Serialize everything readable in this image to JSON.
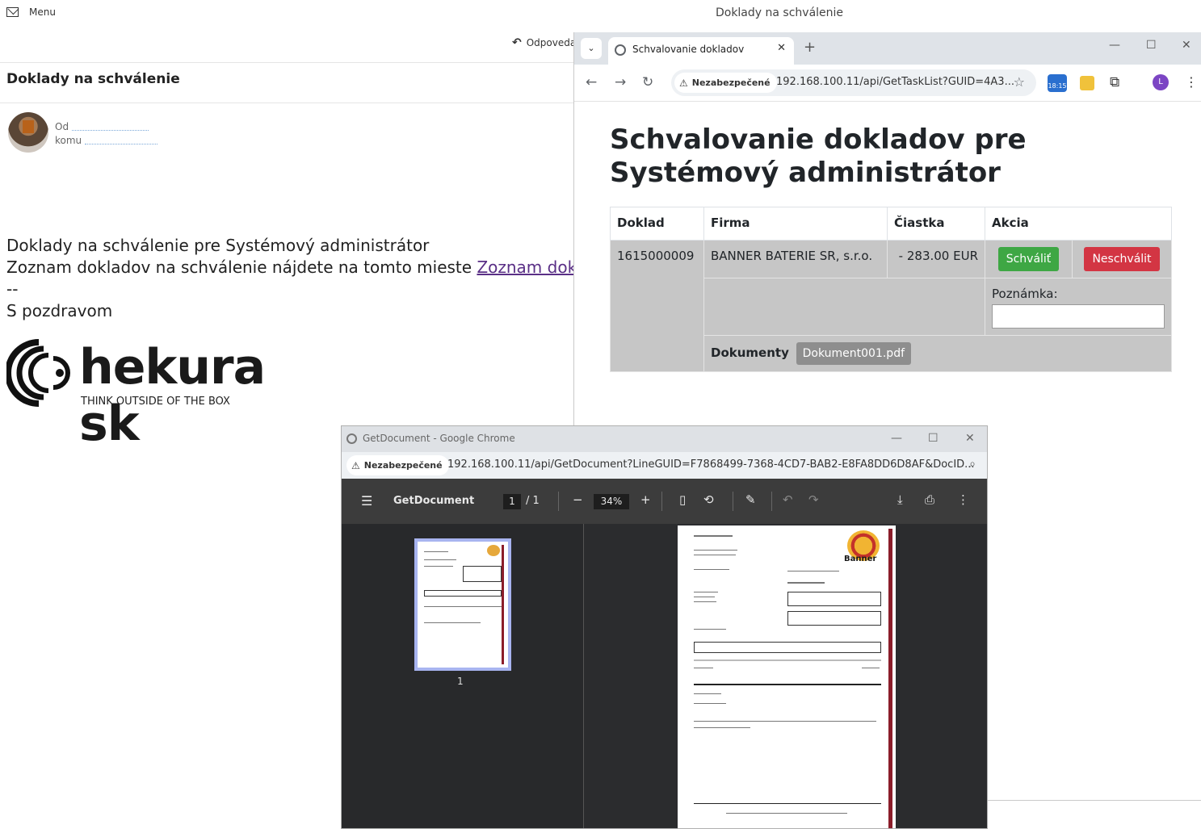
{
  "mail": {
    "menu_label": "Menu",
    "window_title": "Doklady na schválenie",
    "reply_label": "Odpoveda",
    "subject": "Doklady na schválenie",
    "from_prefix": "Od",
    "to_prefix": "komu",
    "body_line1": "Doklady na schválenie pre Systémový administrátor",
    "body_line2_prefix": "Zoznam dokladov na schválenie nájdete na tomto mieste ",
    "body_link": "Zoznam dokladov",
    "body_sep": "--",
    "body_greeting": "S pozdravom",
    "logo_text": "hekura sk",
    "logo_tagline": "THINK OUTSIDE OF THE BOX"
  },
  "browser1": {
    "tab_title": "Schvalovanie dokladov",
    "security_label": "Nezabezpečené",
    "url": "192.168.100.11/api/GetTaskList?GUID=4A3...",
    "ext_clock_label": "18:15",
    "profile_initial": "L",
    "page_title": "Schvalovanie dokladov pre Systémový administrátor",
    "table": {
      "headers": [
        "Doklad",
        "Firma",
        "Čiastka",
        "Akcia"
      ],
      "doc_number": "1615000009",
      "company": "BANNER BATERIE SR, s.r.o.",
      "amount": "- 283.00 EUR",
      "approve_label": "Schváliť",
      "reject_label": "Neschválit",
      "note_label": "Poznámka:",
      "documents_label": "Dokumenty",
      "document_file": "Dokument001.pdf"
    }
  },
  "browser2": {
    "window_title": "GetDocument - Google Chrome",
    "security_label": "Nezabezpečené",
    "url": "192.168.100.11/api/GetDocument?LineGUID=F7868499-7368-4CD7-BAB2-E8FA8DD6D8AF&DocID...",
    "pdf_title": "GetDocument",
    "page_current": "1",
    "page_total": "/ 1",
    "zoom": "34%",
    "thumb_label": "1",
    "doc_brand": "Banner"
  }
}
